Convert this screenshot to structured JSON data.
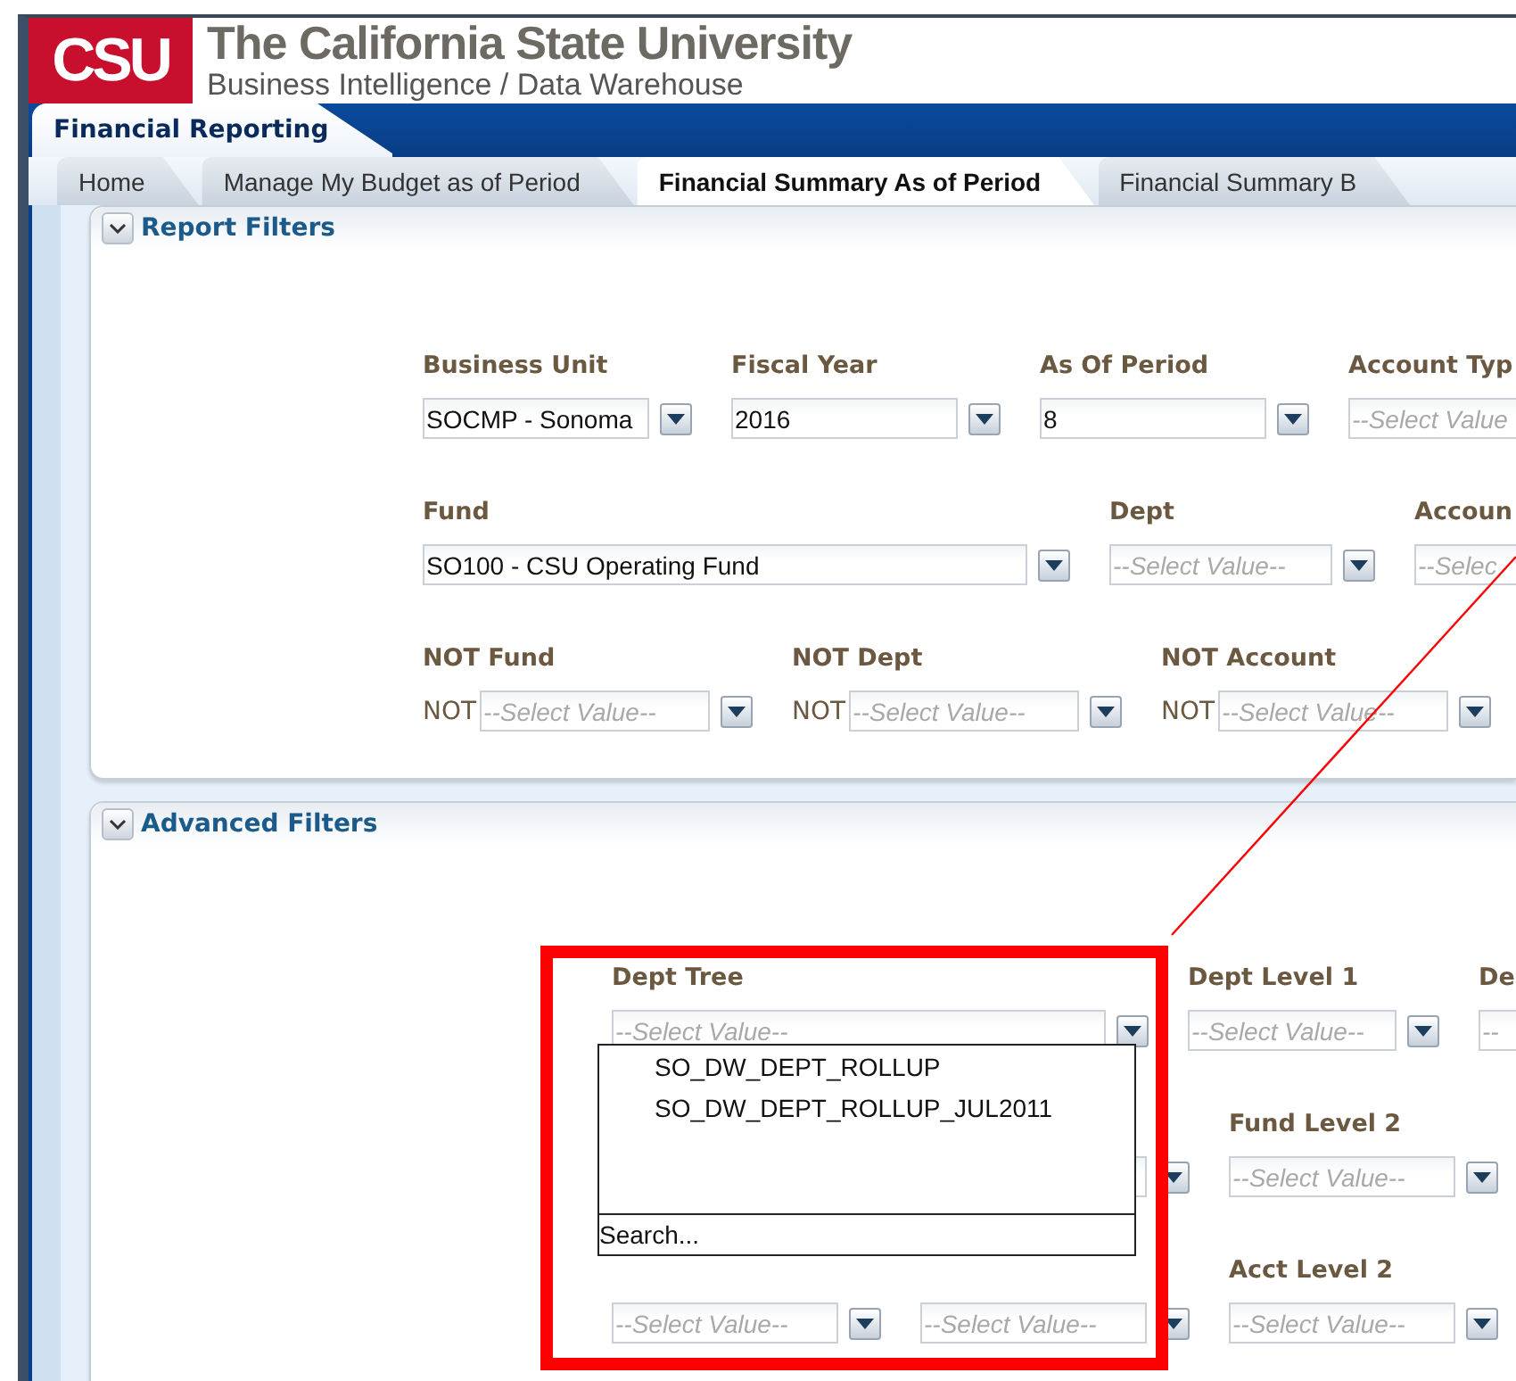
{
  "header": {
    "logo": "CSU",
    "title": "The California State University",
    "subtitle": "Business Intelligence / Data Warehouse"
  },
  "app_tab": "Financial Reporting",
  "tabs": [
    {
      "label": "Home",
      "selected": false
    },
    {
      "label": "Manage My Budget as of Period",
      "selected": false
    },
    {
      "label": "Financial Summary As of Period",
      "selected": true
    },
    {
      "label": "Financial Summary B",
      "selected": false
    }
  ],
  "sections": [
    {
      "title": "Report Filters",
      "expanded": true,
      "lines": [
        [
          {
            "kind": "field",
            "label": "Business Unit",
            "value": "SOCMP - Sonoma"
          },
          {
            "kind": "field",
            "label": "Fiscal Year",
            "value": "2016"
          },
          {
            "kind": "field",
            "label": "As Of Period",
            "value": "8"
          },
          {
            "kind": "cut",
            "label": "Account Typ",
            "placeholder": "--Select Value"
          }
        ],
        [
          {
            "kind": "field",
            "label": "Fund",
            "value": "SO100 - CSU Operating Fund"
          },
          {
            "kind": "field",
            "label": "Dept",
            "placeholder": "--Select Value--"
          },
          {
            "kind": "cut",
            "label": "Accoun",
            "placeholder": "--Selec"
          }
        ],
        [
          {
            "kind": "field",
            "label": "NOT Fund",
            "prefix": "NOT",
            "placeholder": "--Select Value--"
          },
          {
            "kind": "field",
            "label": "NOT Dept",
            "prefix": "NOT",
            "placeholder": "--Select Value--"
          },
          {
            "kind": "field",
            "label": "NOT Account",
            "prefix": "NOT",
            "placeholder": "--Select Value--"
          }
        ]
      ]
    },
    {
      "title": "Advanced Filters",
      "expanded": true,
      "lines": [
        [
          {
            "kind": "field",
            "label": "Dept Tree",
            "placeholder": "--Select Value--",
            "open": true
          },
          {
            "kind": "field",
            "label": "Dept Level 1",
            "placeholder": "--Select Value--"
          },
          {
            "kind": "cut",
            "label": "De",
            "placeholder": "--"
          }
        ],
        [
          {
            "kind": "spacer"
          },
          {
            "kind": "covered"
          },
          {
            "kind": "field",
            "label": "Fund Level 2",
            "placeholder": "--Select Value--"
          }
        ],
        [
          {
            "kind": "field",
            "placeholder": "--Select Value--"
          },
          {
            "kind": "field",
            "placeholder": "--Select Value--"
          },
          {
            "kind": "field",
            "label": "Acct Level 2",
            "placeholder": "--Select Value--"
          }
        ]
      ]
    }
  ],
  "dropdown": {
    "items": [
      "SO_DW_DEPT_ROLLUP",
      "SO_DW_DEPT_ROLLUP_JUL2011"
    ],
    "search_placeholder": "Search..."
  }
}
